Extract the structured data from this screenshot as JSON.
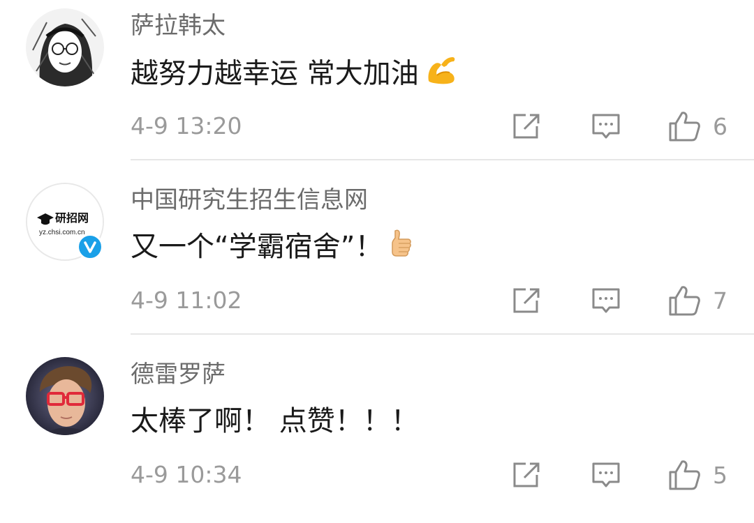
{
  "comments": [
    {
      "username": "萨拉韩太",
      "content": "越努力越幸运 常大加油",
      "emoji": "flexed-biceps",
      "timestamp": "4-9 13:20",
      "likes": "6",
      "verified": false
    },
    {
      "username": "中国研究生招生信息网",
      "content": "又一个“学霸宿舍”！",
      "emoji": "thumbs-up",
      "timestamp": "4-9 11:02",
      "likes": "7",
      "verified": true,
      "avatar_text": "研招网",
      "avatar_subtext": "yz.chsi.com.cn"
    },
    {
      "username": "德雷罗萨",
      "content": "太棒了啊！ 点赞！！！",
      "timestamp": "4-9 10:34",
      "likes": "5",
      "verified": false
    }
  ],
  "icons": {
    "share": "share-edit-icon",
    "reply": "comment-bubble-icon",
    "like": "thumbs-up-icon",
    "verified": "verified-v-badge-icon"
  },
  "colors": {
    "username": "#6b6b6b",
    "content": "#1a1a1a",
    "meta": "#9a9a9a",
    "verified": "#1aa0e8",
    "divider": "#e6e6e6"
  }
}
